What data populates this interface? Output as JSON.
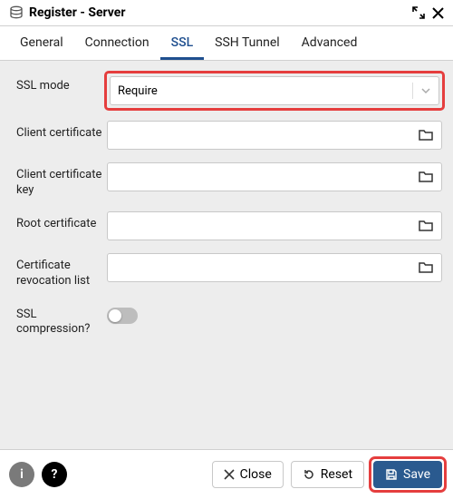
{
  "window": {
    "title": "Register - Server"
  },
  "tabs": [
    "General",
    "Connection",
    "SSL",
    "SSH Tunnel",
    "Advanced"
  ],
  "active_tab": "SSL",
  "fields": {
    "ssl_mode": {
      "label": "SSL mode",
      "value": "Require"
    },
    "client_cert": {
      "label": "Client certificate",
      "value": ""
    },
    "client_cert_key": {
      "label": "Client certificate key",
      "value": ""
    },
    "root_cert": {
      "label": "Root certificate",
      "value": ""
    },
    "crl": {
      "label": "Certificate revocation list",
      "value": ""
    },
    "ssl_compression": {
      "label": "SSL compression?",
      "value": false
    }
  },
  "footer": {
    "close": "Close",
    "reset": "Reset",
    "save": "Save"
  }
}
